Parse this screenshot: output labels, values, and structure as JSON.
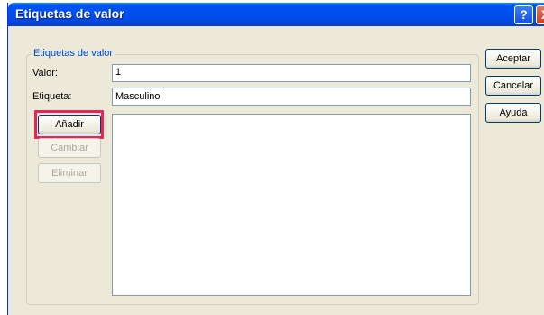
{
  "window": {
    "title": "Etiquetas de valor",
    "help_glyph": "?",
    "close_glyph": "X"
  },
  "group": {
    "label": "Etiquetas de valor"
  },
  "fields": {
    "valor_label": "Valor:",
    "valor_value": "1",
    "etiqueta_label": "Etiqueta:",
    "etiqueta_value": "Masculino"
  },
  "buttons": {
    "anadir": "Añadir",
    "cambiar": "Cambiar",
    "eliminar": "Eliminar",
    "aceptar": "Aceptar",
    "cancelar": "Cancelar",
    "ayuda": "Ayuda"
  },
  "list": {
    "items": []
  },
  "colors": {
    "highlight": "#e8255b",
    "title_bar": "#0050ee",
    "dialog_bg": "#ece9d8"
  }
}
